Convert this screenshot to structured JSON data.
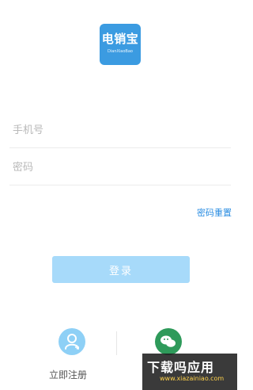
{
  "logo": {
    "title": "电销宝",
    "subtitle": "DianXiaoBao"
  },
  "form": {
    "phone_placeholder": "手机号",
    "password_placeholder": "密码"
  },
  "links": {
    "reset_password": "密码重置"
  },
  "buttons": {
    "login": "登录"
  },
  "bottom": {
    "register_label": "立即注册"
  },
  "watermark": {
    "title": "下载吗应用",
    "url": "www.xiazainiao.com"
  }
}
